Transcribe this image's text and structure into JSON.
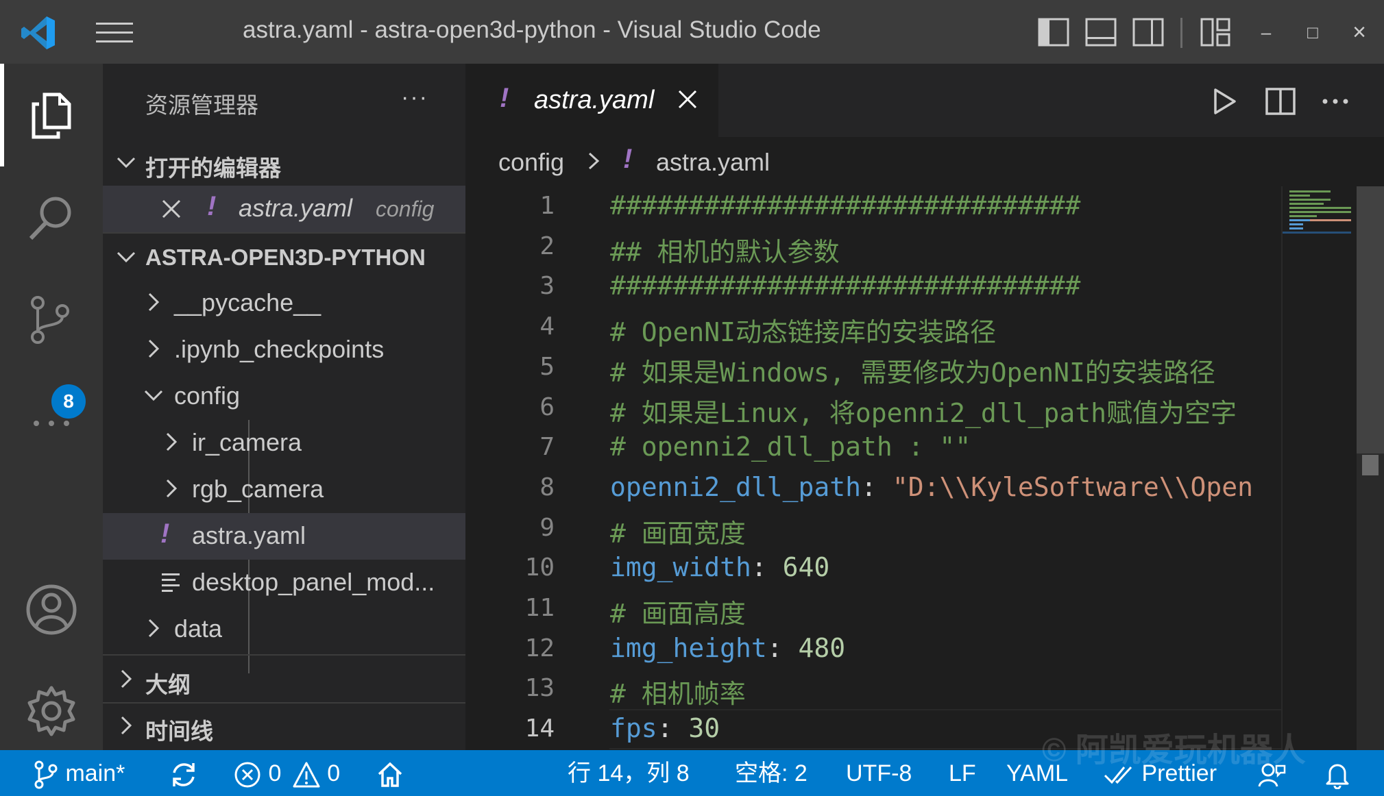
{
  "window": {
    "title": "astra.yaml - astra-open3d-python - Visual Studio Code",
    "minimize": "–",
    "maximize": "□",
    "close": "×"
  },
  "activity": {
    "scm_badge": "8"
  },
  "sidebar": {
    "title": "资源管理器",
    "more": "···",
    "open_editors_section": "打开的编辑器",
    "open_editor_file": "astra.yaml",
    "open_editor_folder": "config",
    "project_section": "ASTRA-OPEN3D-PYTHON",
    "tree": [
      {
        "label": "__pycache__"
      },
      {
        "label": ".ipynb_checkpoints"
      },
      {
        "label": "config"
      },
      {
        "label": "ir_camera"
      },
      {
        "label": "rgb_camera"
      },
      {
        "label": "astra.yaml"
      },
      {
        "label": "desktop_panel_mod..."
      },
      {
        "label": "data"
      }
    ],
    "outline_section": "大纲",
    "timeline_section": "时间线"
  },
  "tab": {
    "label": "astra.yaml",
    "modified_marker": "!"
  },
  "breadcrumbs": {
    "folder": "config",
    "file": "astra.yaml"
  },
  "code": {
    "lines": [
      {
        "n": "1",
        "comment": "##############################"
      },
      {
        "n": "2",
        "comment": "## 相机的默认参数"
      },
      {
        "n": "3",
        "comment": "##############################"
      },
      {
        "n": "4",
        "comment": "# OpenNI动态链接库的安装路径"
      },
      {
        "n": "5",
        "comment": "# 如果是Windows, 需要修改为OpenNI的安装路径"
      },
      {
        "n": "6",
        "comment": "# 如果是Linux, 将openni2_dll_path赋值为空字"
      },
      {
        "n": "7",
        "comment": "# openni2_dll_path : \"\""
      },
      {
        "n": "8",
        "key": "openni2_dll_path",
        "sep": ": ",
        "str": "\"D:\\\\KyleSoftware\\\\Open"
      },
      {
        "n": "9",
        "comment": "# 画面宽度"
      },
      {
        "n": "10",
        "key": "img_width",
        "sep": ": ",
        "num": "640"
      },
      {
        "n": "11",
        "comment": "# 画面高度"
      },
      {
        "n": "12",
        "key": "img_height",
        "sep": ": ",
        "num": "480"
      },
      {
        "n": "13",
        "comment": "# 相机帧率"
      },
      {
        "n": "14",
        "key": "fps",
        "sep": ": ",
        "num": "30"
      }
    ]
  },
  "status": {
    "branch": "main*",
    "errors": "0",
    "warnings": "0",
    "cursor": "行 14，列 8",
    "indent": "空格: 2",
    "encoding": "UTF-8",
    "eol": "LF",
    "language": "YAML",
    "formatter": "Prettier"
  },
  "watermark": "© 阿凯爱玩机器人",
  "colors": {
    "accent": "#007acc",
    "comment": "#6a9955",
    "key": "#569cd6",
    "string": "#ce9178",
    "number": "#b5cea8",
    "yaml_icon": "#a074c4"
  }
}
